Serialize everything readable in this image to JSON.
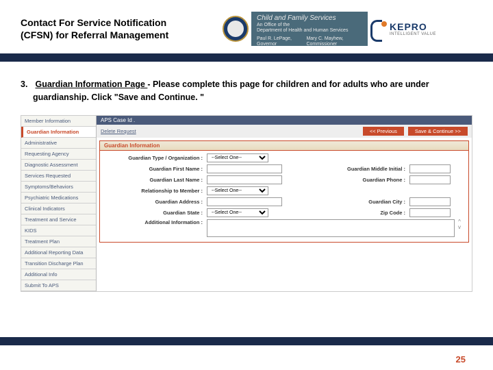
{
  "header": {
    "title_line1": "Contact For Service Notification",
    "title_line2": "(CFSN) for Referral Management",
    "cfs_line1": "Child and Family Services",
    "cfs_line2": "An Office of the",
    "cfs_line3": "Department of Health and Human Services",
    "cfs_gov": "Paul R. LePage, Governor",
    "cfs_comm": "Mary C. Mayhew, Commissioner",
    "kepro": "KEPRO",
    "kepro_sub": "INTELLIGENT VALUE"
  },
  "instruction": {
    "number": "3.",
    "underlined": "Guardian Information Page ",
    "rest1": "- Please complete this page for children and for adults who are under",
    "rest2": "guardianship. Click \"Save and Continue. \""
  },
  "app": {
    "case_id": "APS Case Id .",
    "delete_link": "Delete Request",
    "btn_prev": "<< Previous",
    "btn_next": "Save & Continue >>",
    "sidebar": [
      "Member Information",
      "Guardian Information",
      "Administrative",
      "Requesting Agency",
      "Diagnostic Assessment",
      "Services Requested",
      "Symptoms/Behaviors",
      "Psychiatric Medications",
      "Clinical Indicators",
      "Treatment and Service",
      "KIDS",
      "Treatment Plan",
      "Additional Reporting Data",
      "Transition Discharge Plan",
      "Additional Info",
      "Submit To APS"
    ],
    "panel_title": "Guardian Information",
    "labels": {
      "type": "Guardian Type / Organization :",
      "first": "Guardian First Name :",
      "last": "Guardian Last Name :",
      "rel": "Relationship to Member :",
      "addr": "Guardian Address :",
      "state": "Guardian State :",
      "addl": "Additional Information :",
      "mi": "Guardian Middle Initial :",
      "phone": "Guardian Phone :",
      "city": "Guardian City :",
      "zip": "Zip Code :"
    },
    "select_placeholder": "--Select One--"
  },
  "page_number": "25"
}
